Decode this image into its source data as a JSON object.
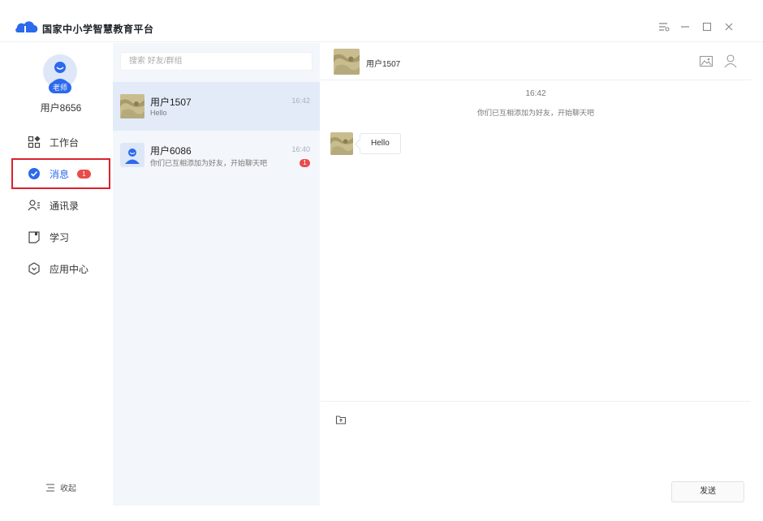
{
  "app": {
    "title": "国家中小学智慧教育平台"
  },
  "user": {
    "name": "用户8656",
    "role_badge": "老师"
  },
  "nav": {
    "items": [
      {
        "label": "工作台",
        "icon": "grid-icon"
      },
      {
        "label": "消息",
        "icon": "message-check-icon",
        "badge": "1",
        "active": true
      },
      {
        "label": "通讯录",
        "icon": "contacts-icon"
      },
      {
        "label": "学习",
        "icon": "book-icon"
      },
      {
        "label": "应用中心",
        "icon": "app-center-icon"
      }
    ],
    "collapse_label": "收起"
  },
  "search": {
    "placeholder": "搜索 好友/群组"
  },
  "conversations": [
    {
      "name": "用户1507",
      "last_message": "Hello",
      "time": "16:42",
      "selected": true
    },
    {
      "name": "用户6086",
      "last_message": "你们已互相添加为好友，开始聊天吧",
      "time": "16:40",
      "unread": "1"
    }
  ],
  "chat": {
    "title": "用户1507",
    "system_time": "16:42",
    "system_note": "你们已互相添加为好友，开始聊天吧",
    "messages": [
      {
        "text": "Hello"
      }
    ],
    "send_label": "发送"
  },
  "colors": {
    "accent": "#2b69ee",
    "badge": "#e94b4b",
    "highlight_border": "#d9232e",
    "list_bg": "#f3f6fb"
  }
}
